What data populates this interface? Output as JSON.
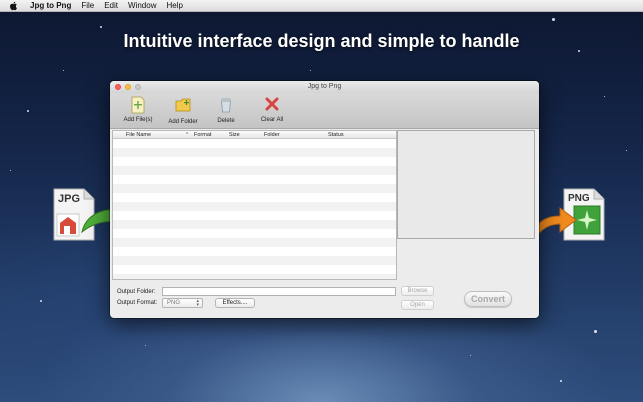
{
  "menubar": {
    "app_name": "Jpg to Png",
    "items": [
      "File",
      "Edit",
      "Window",
      "Help"
    ]
  },
  "headline": "Intuitive interface design and simple to handle",
  "window": {
    "title": "Jpg to Png",
    "toolbar": [
      {
        "label": "Add File(s)",
        "icon": "add-file-icon"
      },
      {
        "label": "Add Folder",
        "icon": "add-folder-icon"
      },
      {
        "label": "Delete",
        "icon": "trash-icon"
      },
      {
        "label": "Clear All",
        "icon": "clear-x-icon"
      }
    ],
    "table": {
      "columns": [
        "File Name",
        "Format",
        "Size",
        "Folder",
        "Status"
      ],
      "rows": []
    },
    "output_folder": {
      "label": "Output Folder:",
      "value": ""
    },
    "output_format": {
      "label": "Output Format:",
      "value": "PNG"
    },
    "buttons": {
      "effects": "Effects....",
      "browse": "Browse",
      "open": "Open",
      "convert": "Convert"
    }
  },
  "badges": {
    "left": "JPG",
    "right": "PNG"
  },
  "colors": {
    "close": "#fc605b",
    "minimize": "#fdbc40",
    "arrow_green": "#4fae3a",
    "arrow_orange": "#f08a1f",
    "delete_red": "#d9443f"
  }
}
